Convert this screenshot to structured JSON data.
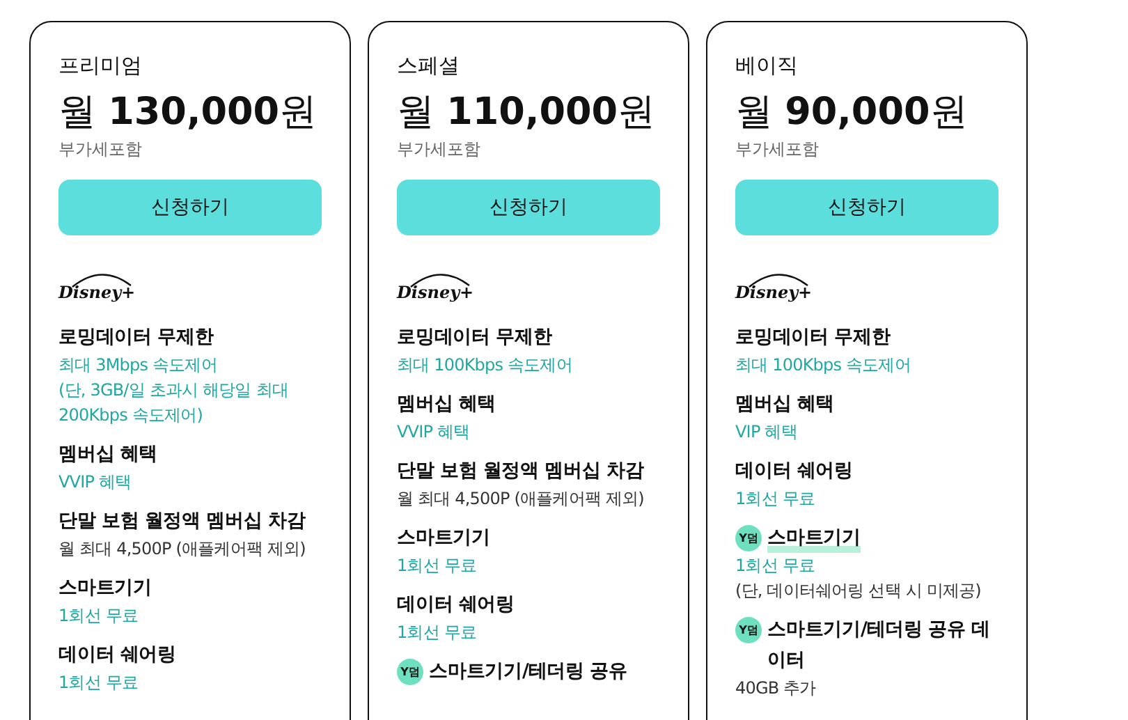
{
  "plans": [
    {
      "name": "프리미엄",
      "price": "월 **130,000**원",
      "tax_note": "부가세포함",
      "button": "신청하기",
      "logo": "Disney+",
      "features": [
        {
          "title": "로밍데이터 무제한",
          "details": [
            {
              "kind": "accent",
              "text": "최대 3Mbps 속도제어"
            },
            {
              "kind": "accent",
              "text": "(단, 3GB/일 초과시 해당일 최대 200Kbps 속도제어)"
            }
          ]
        },
        {
          "title": "멤버십 혜택",
          "details": [
            {
              "kind": "accent",
              "text": "VVIP 혜택"
            }
          ]
        },
        {
          "title": "단말 보험 월정액 멤버십 차감",
          "details": [
            {
              "kind": "note",
              "text": "월 최대 4,500P (애플케어팩 제외)"
            }
          ]
        },
        {
          "title": "스마트기기",
          "details": [
            {
              "kind": "accent",
              "text": "1회선 무료"
            }
          ]
        },
        {
          "title": "데이터 쉐어링",
          "details": [
            {
              "kind": "accent",
              "text": "1회선 무료"
            }
          ]
        }
      ]
    },
    {
      "name": "스페셜",
      "price": "월 **110,000**원",
      "tax_note": "부가세포함",
      "button": "신청하기",
      "logo": "Disney+",
      "features": [
        {
          "title": "로밍데이터 무제한",
          "details": [
            {
              "kind": "accent",
              "text": "최대 100Kbps 속도제어"
            }
          ]
        },
        {
          "title": "멤버십 혜택",
          "details": [
            {
              "kind": "accent",
              "text": "VVIP 혜택"
            }
          ]
        },
        {
          "title": "단말 보험 월정액 멤버십 차감",
          "details": [
            {
              "kind": "note",
              "text": "월 최대 4,500P (애플케어팩 제외)"
            }
          ]
        },
        {
          "title": "스마트기기",
          "details": [
            {
              "kind": "accent",
              "text": "1회선 무료"
            }
          ]
        },
        {
          "title": "데이터 쉐어링",
          "details": [
            {
              "kind": "accent",
              "text": "1회선 무료"
            }
          ]
        },
        {
          "title": "스마트기기/테더링 공유",
          "badge": "Y덤"
        }
      ]
    },
    {
      "name": "베이직",
      "price": "월 **90,000**원",
      "tax_note": "부가세포함",
      "button": "신청하기",
      "logo": "Disney+",
      "features": [
        {
          "title": "로밍데이터 무제한",
          "details": [
            {
              "kind": "accent",
              "text": "최대 100Kbps 속도제어"
            }
          ]
        },
        {
          "title": "멤버십 혜택",
          "details": [
            {
              "kind": "accent",
              "text": "VIP 혜택"
            }
          ]
        },
        {
          "title": "데이터 쉐어링",
          "details": [
            {
              "kind": "accent",
              "text": "1회선 무료"
            }
          ]
        },
        {
          "title": "스마트기기",
          "badge": "Y덤",
          "highlighted": true,
          "details": [
            {
              "kind": "accent",
              "text": "1회선 무료"
            },
            {
              "kind": "note",
              "text": "(단, 데이터쉐어링 선택 시 미제공)"
            }
          ]
        },
        {
          "title": "스마트기기/테더링 공유 데이터",
          "badge": "Y덤",
          "details": [
            {
              "kind": "note",
              "text": "40GB 추가"
            }
          ]
        }
      ]
    }
  ]
}
